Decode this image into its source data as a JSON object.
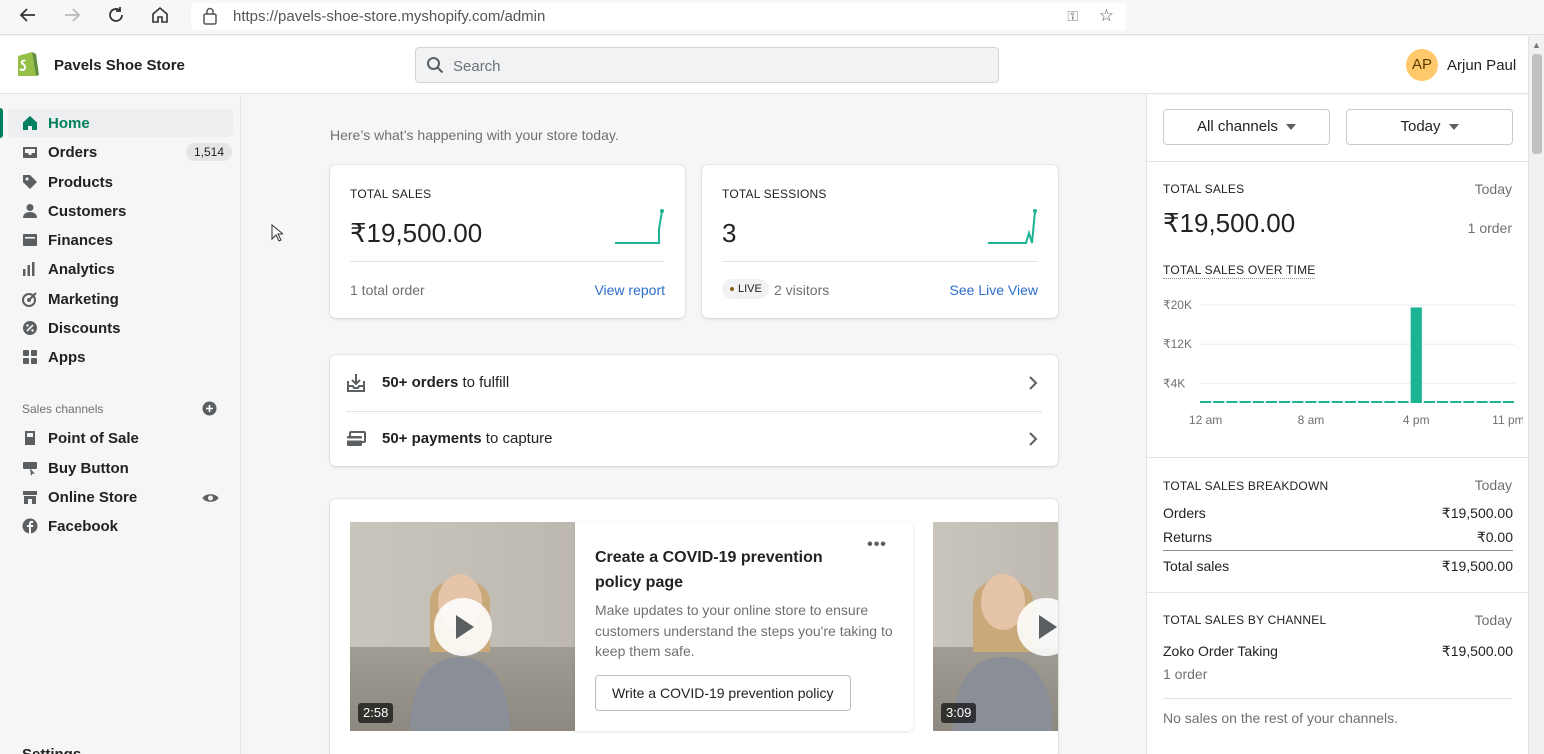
{
  "browser": {
    "url": "https://pavels-shoe-store.myshopify.com/admin"
  },
  "topbar": {
    "store_name": "Pavels Shoe Store",
    "search_placeholder": "Search",
    "user_initials": "AP",
    "user_name": "Arjun Paul"
  },
  "sidebar": {
    "items": [
      {
        "label": "Home",
        "icon": "home-icon",
        "active": true
      },
      {
        "label": "Orders",
        "icon": "orders-icon",
        "badge": "1,514"
      },
      {
        "label": "Products",
        "icon": "tag-icon"
      },
      {
        "label": "Customers",
        "icon": "person-icon"
      },
      {
        "label": "Finances",
        "icon": "bank-icon"
      },
      {
        "label": "Analytics",
        "icon": "bar-chart-icon"
      },
      {
        "label": "Marketing",
        "icon": "target-icon"
      },
      {
        "label": "Discounts",
        "icon": "discount-icon"
      },
      {
        "label": "Apps",
        "icon": "apps-icon"
      }
    ],
    "sales_channels_heading": "Sales channels",
    "channels": [
      {
        "label": "Point of Sale",
        "icon": "pos-icon"
      },
      {
        "label": "Buy Button",
        "icon": "buy-button-icon"
      },
      {
        "label": "Online Store",
        "icon": "store-icon"
      },
      {
        "label": "Facebook",
        "icon": "facebook-icon"
      }
    ],
    "settings_label": "Settings"
  },
  "main": {
    "greeting": "Here’s what’s happening with your store today.",
    "total_sales": {
      "label": "TOTAL SALES",
      "value": "₹19,500.00",
      "footer": "1 total order",
      "link": "View report"
    },
    "total_sessions": {
      "label": "TOTAL SESSIONS",
      "value": "3",
      "live_badge": "LIVE",
      "visitors": "2 visitors",
      "link": "See Live View"
    },
    "tasks": [
      {
        "bold": "50+ orders",
        "rest": " to fulfill",
        "icon": "fulfill-icon"
      },
      {
        "bold": "50+ payments",
        "rest": " to capture",
        "icon": "payment-icon"
      }
    ],
    "video": {
      "title": "Create a COVID-19 prevention policy page",
      "description": "Make updates to your online store to ensure customers understand the steps you're taking to keep them safe.",
      "button": "Write a COVID-19 prevention policy",
      "duration": "2:58",
      "next_duration": "3:09"
    }
  },
  "right_panel": {
    "channel_select": "All channels",
    "date_select": "Today",
    "total_sales": {
      "label": "TOTAL SALES",
      "period": "Today",
      "value": "₹19,500.00",
      "orders": "1 order"
    },
    "over_time_label": "TOTAL SALES OVER TIME",
    "breakdown": {
      "label": "TOTAL SALES BREAKDOWN",
      "period": "Today",
      "rows": [
        {
          "name": "Orders",
          "value": "₹19,500.00"
        },
        {
          "name": "Returns",
          "value": "₹0.00"
        },
        {
          "name": "Total sales",
          "value": "₹19,500.00"
        }
      ]
    },
    "by_channel": {
      "label": "TOTAL SALES BY CHANNEL",
      "period": "Today",
      "channel": "Zoko Order Taking",
      "channel_value": "₹19,500.00",
      "channel_orders": "1 order",
      "no_sales": "No sales on the rest of your channels."
    }
  },
  "colors": {
    "accent": "#008060",
    "chart_bar": "#1cb395",
    "link": "#2c6ecb",
    "avatar": "#ffc96b"
  },
  "chart_data": {
    "type": "bar",
    "x": [
      0,
      1,
      2,
      3,
      4,
      5,
      6,
      7,
      8,
      9,
      10,
      11,
      12,
      13,
      14,
      15,
      16,
      17,
      18,
      19,
      20,
      21,
      22,
      23
    ],
    "values": [
      0,
      0,
      0,
      0,
      0,
      0,
      0,
      0,
      0,
      0,
      0,
      0,
      0,
      0,
      0,
      0,
      19500,
      0,
      0,
      0,
      0,
      0,
      0,
      0
    ],
    "y_ticks": [
      "₹20K",
      "₹12K",
      "₹4K"
    ],
    "x_ticks": [
      "12 am",
      "8 am",
      "4 pm",
      "11 pm"
    ],
    "ylim": [
      0,
      20000
    ]
  }
}
